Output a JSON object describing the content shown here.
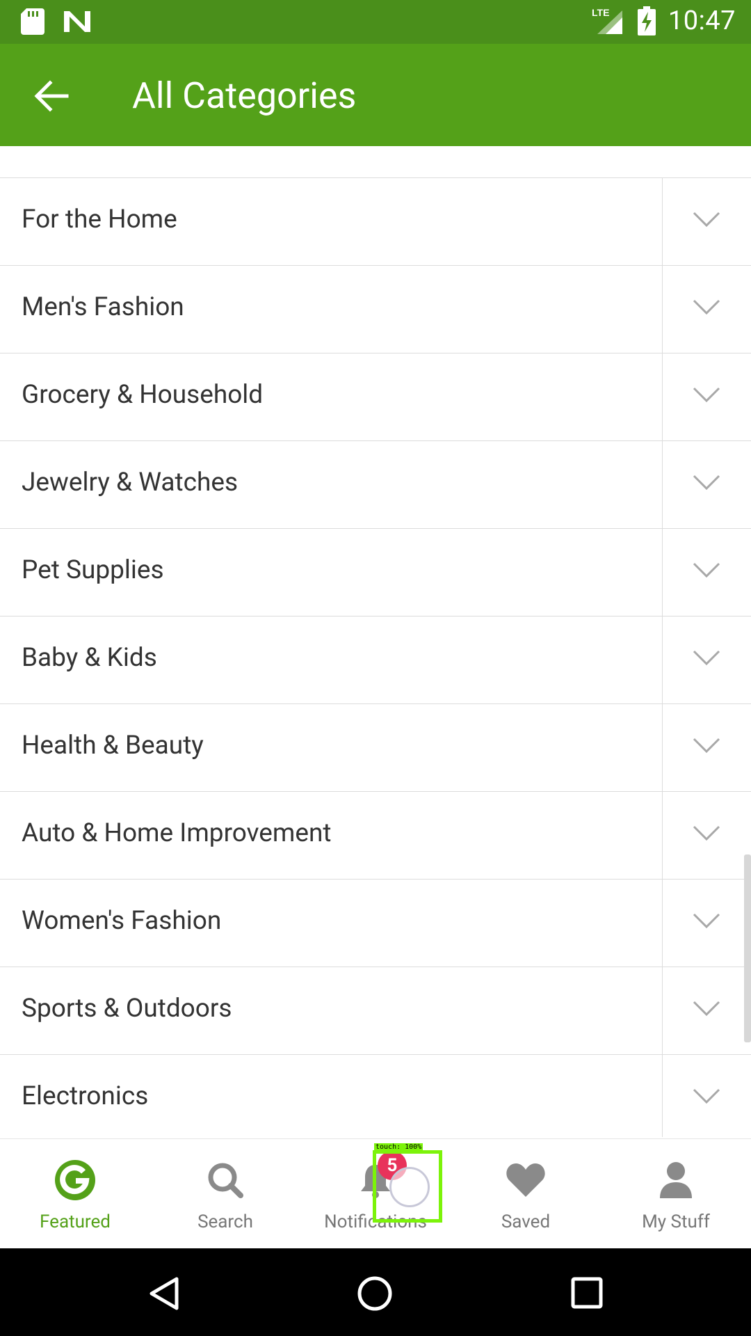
{
  "status": {
    "time": "10:47",
    "network": "LTE"
  },
  "appbar": {
    "title": "All Categories"
  },
  "categories": [
    "For the Home",
    "Men's Fashion",
    "Grocery & Household",
    "Jewelry & Watches",
    "Pet Supplies",
    "Baby & Kids",
    "Health & Beauty",
    "Auto & Home Improvement",
    "Women's Fashion",
    "Sports & Outdoors",
    "Electronics"
  ],
  "bottom_nav": {
    "items": [
      {
        "label": "Featured",
        "icon": "g-logo-icon",
        "active": true
      },
      {
        "label": "Search",
        "icon": "search-icon"
      },
      {
        "label": "Notifications",
        "icon": "bell-icon"
      },
      {
        "label": "Saved",
        "icon": "heart-icon"
      },
      {
        "label": "My Stuff",
        "icon": "person-icon"
      }
    ],
    "notification_badge": "5"
  },
  "touch_overlay": {
    "label": "touch: 100%"
  },
  "colors": {
    "accent": "#54a119",
    "statusbar": "#4a8f1b",
    "badge": "#e8335b",
    "touch": "#7cf30a"
  }
}
